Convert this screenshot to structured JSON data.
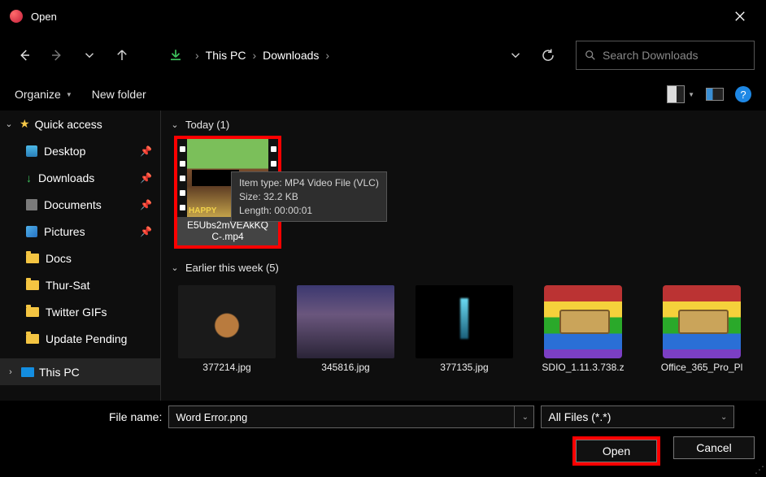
{
  "window": {
    "title": "Open"
  },
  "nav": {
    "path": [
      "This PC",
      "Downloads"
    ],
    "search_placeholder": "Search Downloads"
  },
  "options": {
    "organize": "Organize",
    "new_folder": "New folder",
    "help": "?"
  },
  "sidebar": {
    "quick_access": "Quick access",
    "items": [
      {
        "label": "Desktop"
      },
      {
        "label": "Downloads"
      },
      {
        "label": "Documents"
      },
      {
        "label": "Pictures"
      },
      {
        "label": "Docs"
      },
      {
        "label": "Thur-Sat"
      },
      {
        "label": "Twitter GIFs"
      },
      {
        "label": "Update Pending"
      }
    ],
    "this_pc": "This PC"
  },
  "groups": {
    "today": "Today (1)",
    "earlier": "Earlier this week (5)"
  },
  "selected": {
    "line1": "E5Ubs2mVEAkKQ",
    "line2": "C-.mp4",
    "thumb_text": "HAPPY"
  },
  "tooltip": {
    "l1": "Item type: MP4 Video File (VLC)",
    "l2": "Size: 32.2 KB",
    "l3": "Length: 00:00:01"
  },
  "files": [
    {
      "name": "377214.jpg"
    },
    {
      "name": "345816.jpg"
    },
    {
      "name": "377135.jpg"
    },
    {
      "name": "SDIO_1.11.3.738.z"
    },
    {
      "name": "Office_365_Pro_Pl"
    }
  ],
  "footer": {
    "label": "File name:",
    "value": "Word Error.png",
    "filter": "All Files (*.*)",
    "open": "Open",
    "cancel": "Cancel"
  }
}
